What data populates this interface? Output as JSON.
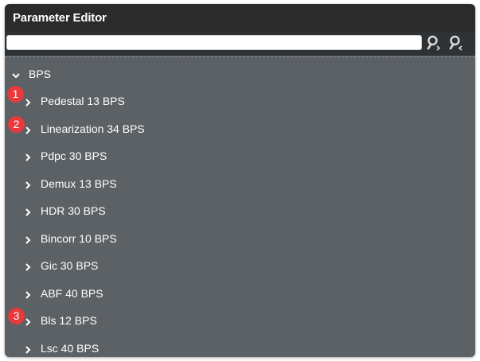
{
  "window": {
    "title": "Parameter Editor"
  },
  "search": {
    "value": "",
    "placeholder": ""
  },
  "tree": {
    "root": {
      "label": "BPS",
      "expanded": true
    },
    "children": [
      {
        "label": "Pedestal 13 BPS"
      },
      {
        "label": "Linearization 34 BPS"
      },
      {
        "label": "Pdpc 30 BPS"
      },
      {
        "label": "Demux 13 BPS"
      },
      {
        "label": "HDR 30 BPS"
      },
      {
        "label": "Bincorr 10 BPS"
      },
      {
        "label": "Gic 30 BPS"
      },
      {
        "label": "ABF 40 BPS"
      },
      {
        "label": "Bls 12 BPS"
      },
      {
        "label": "Lsc 40 BPS"
      }
    ]
  },
  "annotations": [
    {
      "text": "1",
      "row": 0
    },
    {
      "text": "2",
      "row": 1
    },
    {
      "text": "3",
      "row": 8
    }
  ],
  "colors": {
    "panel_bg": "#5c6166",
    "title_bg": "#2b2b2b",
    "badge": "#e8393b",
    "text": "#ffffff"
  }
}
